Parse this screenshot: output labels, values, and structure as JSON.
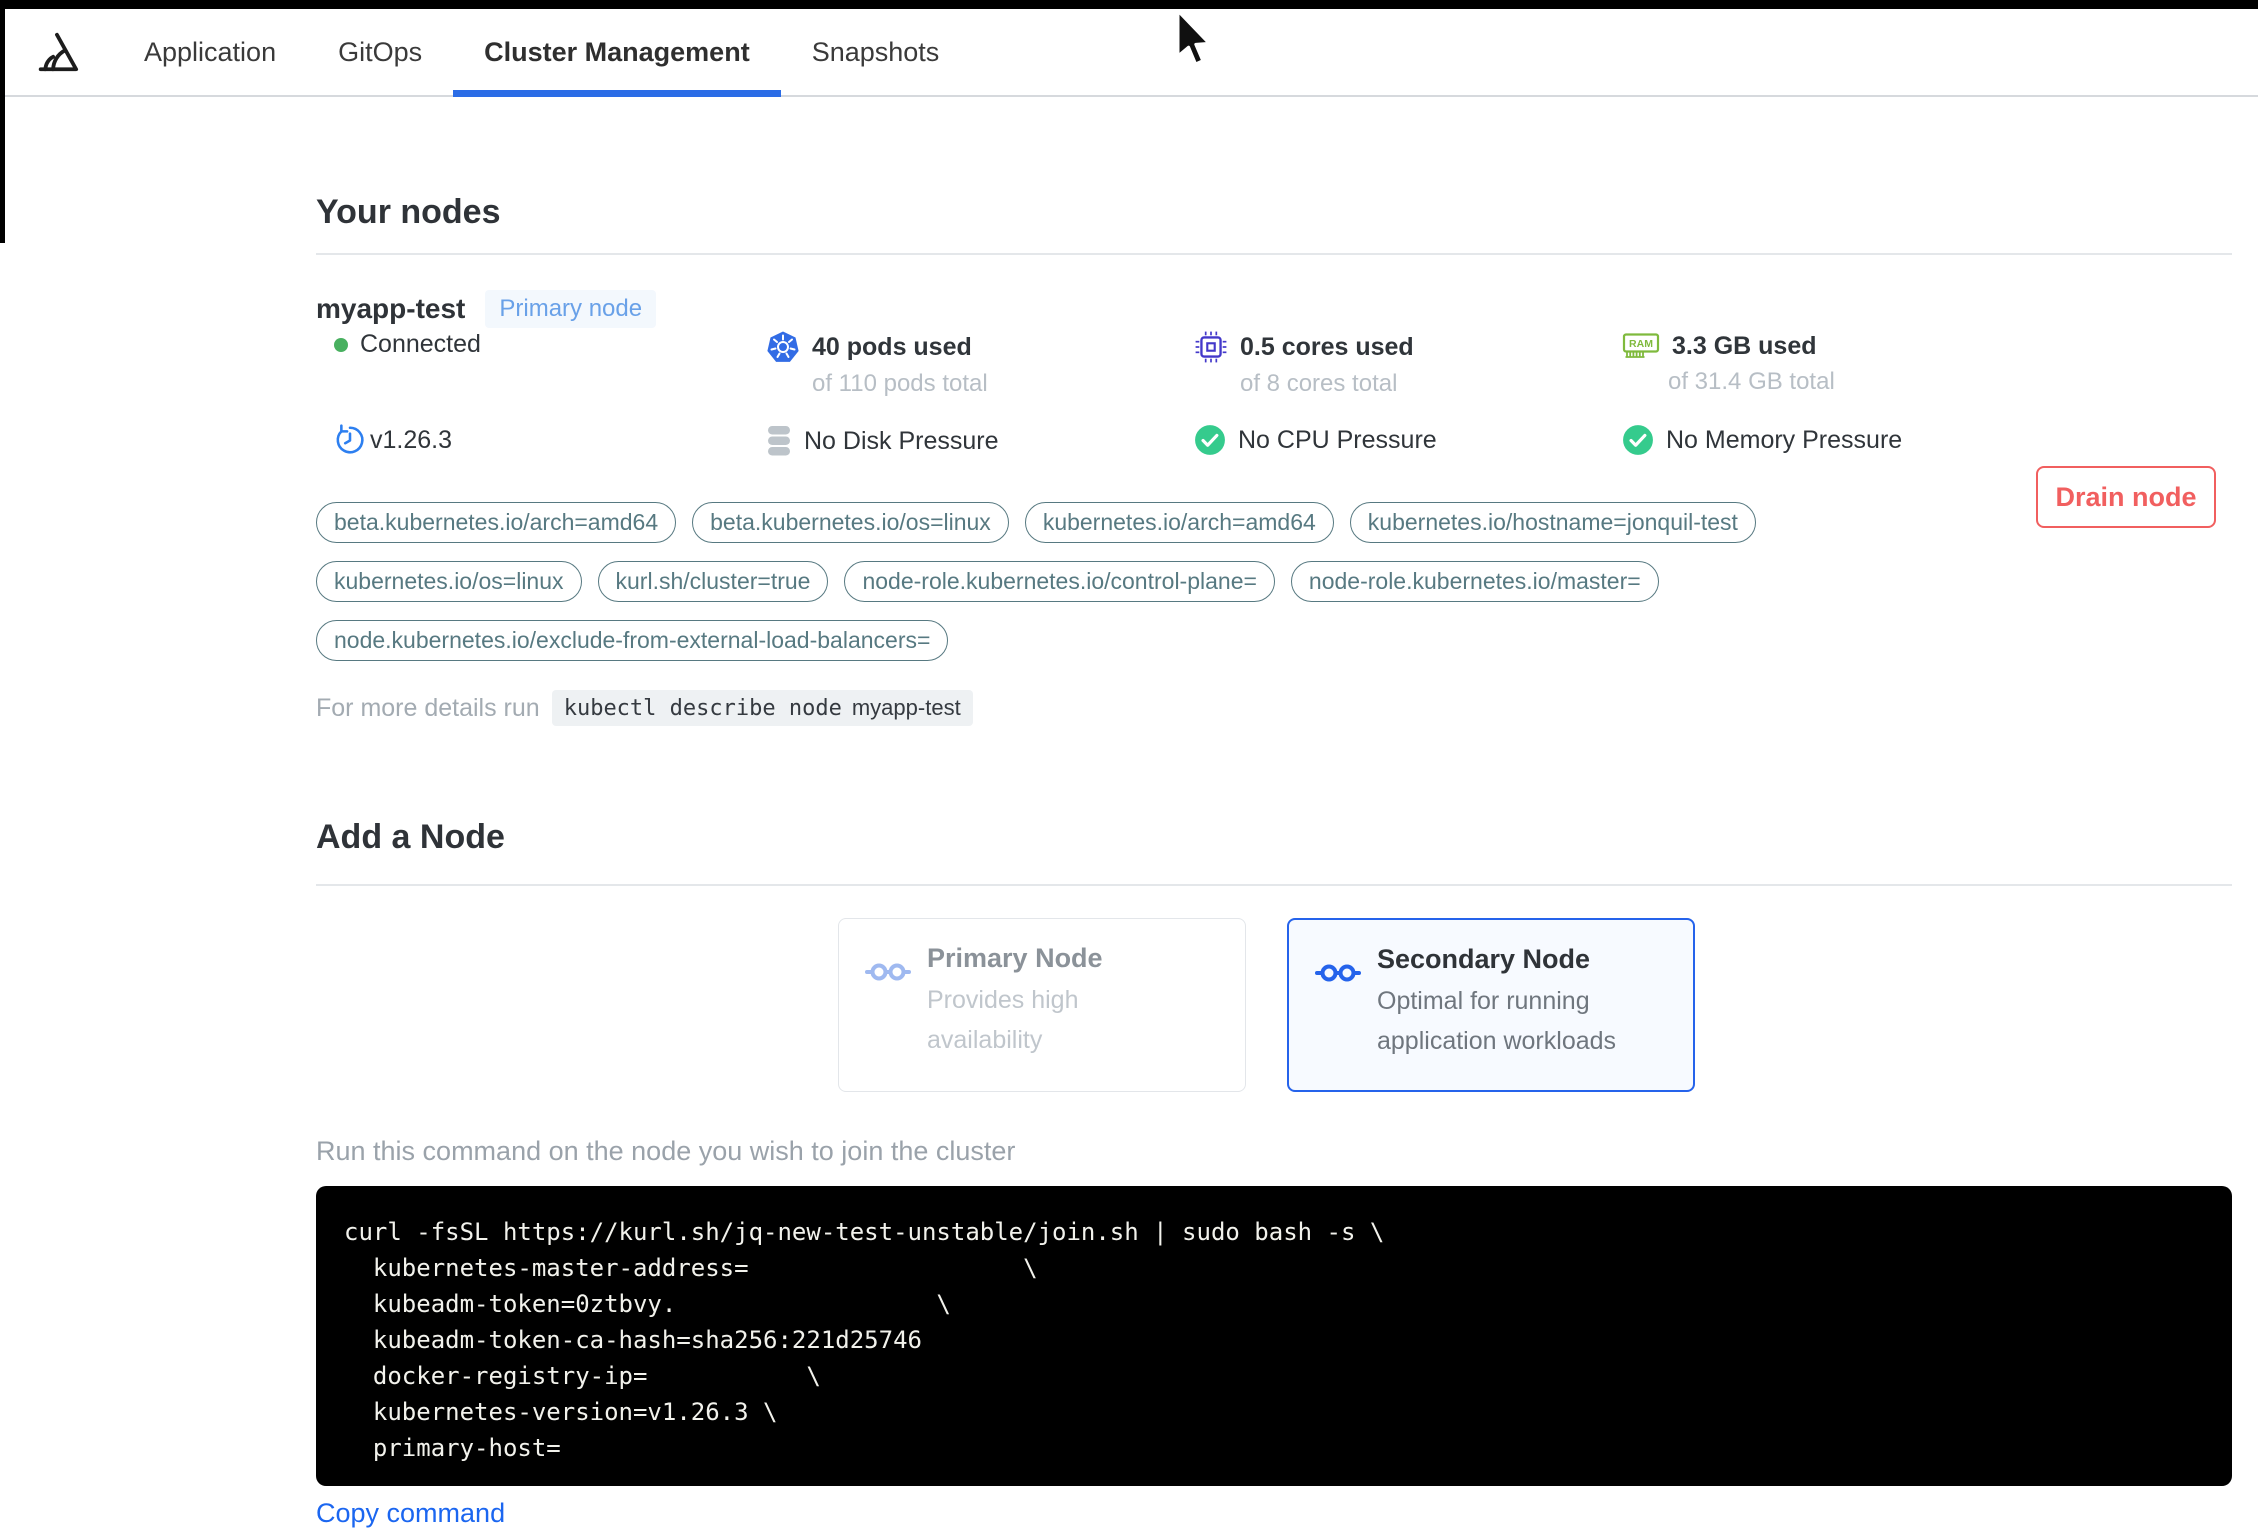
{
  "nav": {
    "tabs": [
      {
        "label": "Application"
      },
      {
        "label": "GitOps"
      },
      {
        "label": "Cluster Management"
      },
      {
        "label": "Snapshots"
      }
    ],
    "active_tab": "Cluster Management"
  },
  "your_nodes": {
    "title": "Your nodes",
    "node": {
      "name": "myapp-test",
      "role_badge": "Primary node",
      "status": "Connected",
      "pods_used": "40 pods used",
      "pods_total": "of 110 pods total",
      "cores_used": "0.5 cores used",
      "cores_total": "of 8 cores total",
      "memory_used": "3.3 GB used",
      "memory_total": "of 31.4 GB total",
      "version": "v1.26.3",
      "disk_pressure": "No Disk Pressure",
      "cpu_pressure": "No CPU Pressure",
      "memory_pressure": "No Memory Pressure",
      "drain_label": "Drain node",
      "labels": [
        "beta.kubernetes.io/arch=amd64",
        "beta.kubernetes.io/os=linux",
        "kubernetes.io/arch=amd64",
        "kubernetes.io/hostname=jonquil-test",
        "kubernetes.io/os=linux",
        "kurl.sh/cluster=true",
        "node-role.kubernetes.io/control-plane=",
        "node-role.kubernetes.io/master=",
        "node.kubernetes.io/exclude-from-external-load-balancers="
      ],
      "details_hint": "For more details run",
      "details_cmd": "kubectl describe node",
      "details_arg": "myapp-test"
    }
  },
  "add_node": {
    "title": "Add a Node",
    "cards": [
      {
        "title": "Primary Node",
        "subtitle": "Provides high availability",
        "selected": false
      },
      {
        "title": "Secondary Node",
        "subtitle": "Optimal for running application workloads",
        "selected": true
      }
    ],
    "instruction": "Run this command on the node you wish to join the cluster",
    "command_lines": [
      "curl -fsSL https://kurl.sh/jq-new-test-unstable/join.sh | sudo bash -s \\",
      "  kubernetes-master-address=                   \\",
      "  kubeadm-token=0ztbvy.                  \\",
      "  kubeadm-token-ca-hash=sha256:221d25746",
      "  docker-registry-ip=           \\",
      "  kubernetes-version=v1.26.3 \\",
      "  primary-host="
    ],
    "copy_label": "Copy command"
  },
  "colors": {
    "accent_blue": "#2563eb",
    "kubernetes_blue": "#326ce5",
    "cpu_indigo": "#4338ca",
    "ram_green": "#7fba3d",
    "check_green": "#35cb8d",
    "status_green": "#48b05f",
    "drain_red": "#f15f5f",
    "label_teal": "#577981"
  }
}
